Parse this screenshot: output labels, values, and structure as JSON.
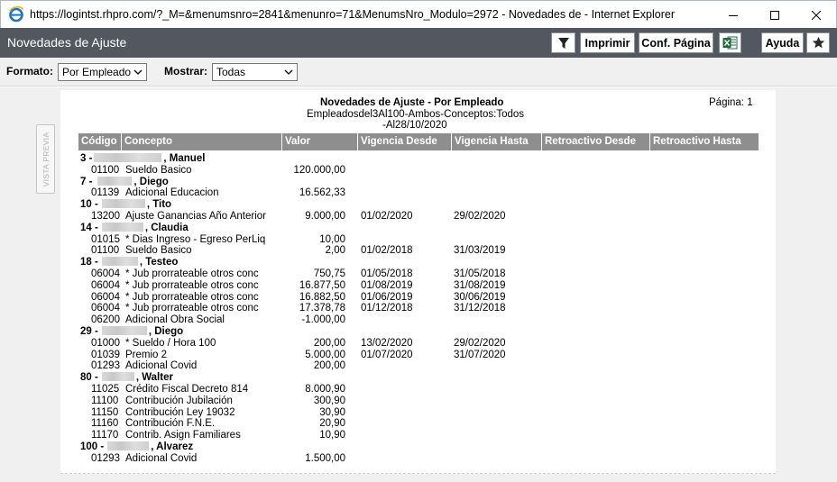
{
  "window": {
    "title": "https://logintst.rhpro.com/?_M=&menumsnro=2841&menunro=71&MenumsNro_Modulo=2972 - Novedades de  - Internet Explorer"
  },
  "header": {
    "title": "Novedades de Ajuste",
    "imprimir": "Imprimir",
    "conf_pagina": "Conf. Página",
    "ayuda": "Ayuda"
  },
  "filters": {
    "formato_label": "Formato:",
    "formato_value": "Por Empleado",
    "mostrar_label": "Mostrar:",
    "mostrar_value": "Todas"
  },
  "side": {
    "vista_previa": "VISTA PREVIA"
  },
  "report": {
    "title": "Novedades de Ajuste - Por Empleado",
    "subtitle1": "Empleadosdel3Al100-Ambos-Conceptos:Todos",
    "subtitle2": "-Al28/10/2020",
    "page": "Página: 1",
    "columns": [
      "Código",
      "Concepto",
      "Valor",
      "Vigencia Desde",
      "Vigencia Hasta",
      "Retroactivo Desde",
      "Retroactivo Hasta"
    ],
    "employees": [
      {
        "prefix": "3 -",
        "name": ", Manuel",
        "rows": [
          {
            "codigo": "01100",
            "concepto": "Sueldo Basico",
            "valor": "120.000,00",
            "desde": "",
            "hasta": ""
          }
        ]
      },
      {
        "prefix": "7 -",
        "name": ", Diego",
        "rows": [
          {
            "codigo": "01139",
            "concepto": "Adicional Educacion",
            "valor": "16.562,33",
            "desde": "",
            "hasta": ""
          }
        ]
      },
      {
        "prefix": "10 -",
        "name": ", Tito",
        "rows": [
          {
            "codigo": "13200",
            "concepto": "Ajuste Ganancias Año Anterior",
            "valor": "9.000,00",
            "desde": "01/02/2020",
            "hasta": "29/02/2020"
          }
        ]
      },
      {
        "prefix": "14 -",
        "name": ", Claudia",
        "rows": [
          {
            "codigo": "01015",
            "concepto": "* Dias Ingreso - Egreso PerLiq",
            "valor": "10,00",
            "desde": "",
            "hasta": ""
          },
          {
            "codigo": "01100",
            "concepto": "Sueldo Basico",
            "valor": "2,00",
            "desde": "01/02/2018",
            "hasta": "31/03/2019"
          }
        ]
      },
      {
        "prefix": "18 -",
        "name": ", Testeo",
        "rows": [
          {
            "codigo": "06004",
            "concepto": "* Jub prorrateable otros conc",
            "valor": "750,75",
            "desde": "01/05/2018",
            "hasta": "31/05/2018"
          },
          {
            "codigo": "06004",
            "concepto": "* Jub prorrateable otros conc",
            "valor": "16.877,50",
            "desde": "01/08/2019",
            "hasta": "31/08/2019"
          },
          {
            "codigo": "06004",
            "concepto": "* Jub prorrateable otros conc",
            "valor": "16.882,50",
            "desde": "01/06/2019",
            "hasta": "30/06/2019"
          },
          {
            "codigo": "06004",
            "concepto": "* Jub prorrateable otros conc",
            "valor": "17.378,78",
            "desde": "01/12/2018",
            "hasta": "31/12/2018"
          },
          {
            "codigo": "06200",
            "concepto": "Adicional Obra Social",
            "valor": "-1.000,00",
            "desde": "",
            "hasta": ""
          }
        ]
      },
      {
        "prefix": "29 -",
        "name": ", Diego",
        "rows": [
          {
            "codigo": "01000",
            "concepto": "* Sueldo / Hora 100",
            "valor": "200,00",
            "desde": "13/02/2020",
            "hasta": "29/02/2020"
          },
          {
            "codigo": "01039",
            "concepto": "Premio 2",
            "valor": "5.000,00",
            "desde": "01/07/2020",
            "hasta": "31/07/2020"
          },
          {
            "codigo": "01293",
            "concepto": "Adicional Covid",
            "valor": "200,00",
            "desde": "",
            "hasta": ""
          }
        ]
      },
      {
        "prefix": "80 -",
        "name": ", Walter",
        "rows": [
          {
            "codigo": "11025",
            "concepto": "Crédito Fiscal Decreto 814",
            "valor": "8.000,90",
            "desde": "",
            "hasta": ""
          },
          {
            "codigo": "11100",
            "concepto": "Contribución Jubilación",
            "valor": "300,90",
            "desde": "",
            "hasta": ""
          },
          {
            "codigo": "11150",
            "concepto": "Contribución Ley 19032",
            "valor": "30,90",
            "desde": "",
            "hasta": ""
          },
          {
            "codigo": "11160",
            "concepto": "Contribución F.N.E.",
            "valor": "20,90",
            "desde": "",
            "hasta": ""
          },
          {
            "codigo": "11170",
            "concepto": "Contrib. Asign Familiares",
            "valor": "10,90",
            "desde": "",
            "hasta": ""
          }
        ]
      },
      {
        "prefix": "100 -",
        "name": ", Alvarez",
        "rows": [
          {
            "codigo": "01293",
            "concepto": "Adicional Covid",
            "valor": "1.500,00",
            "desde": "",
            "hasta": ""
          }
        ]
      }
    ]
  }
}
